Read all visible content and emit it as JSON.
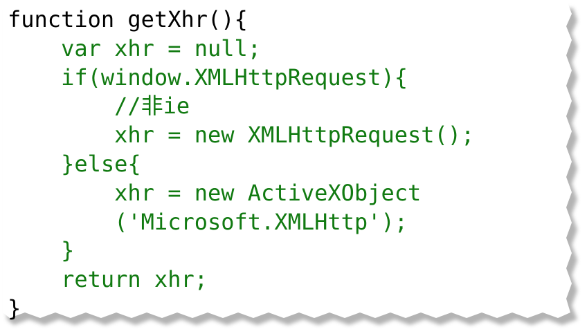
{
  "code": {
    "lines": [
      {
        "text": "function getXhr(){",
        "color": "#000000"
      },
      {
        "text": "    var xhr = null;",
        "color": "#117a11"
      },
      {
        "text": "    if(window.XMLHttpRequest){",
        "color": "#117a11"
      },
      {
        "text": "        //非ie",
        "color": "#117a11"
      },
      {
        "text": "        xhr = new XMLHttpRequest();",
        "color": "#117a11"
      },
      {
        "text": "    }else{",
        "color": "#117a11"
      },
      {
        "text": "        xhr = new ActiveXObject",
        "color": "#117a11"
      },
      {
        "text": "        ('Microsoft.XMLHttp');",
        "color": "#117a11"
      },
      {
        "text": "    }",
        "color": "#117a11"
      },
      {
        "text": "    return xhr;",
        "color": "#117a11"
      },
      {
        "text": "}",
        "color": "#000000"
      }
    ]
  },
  "colors": {
    "keyword_black": "#000000",
    "code_green": "#117a11",
    "paper": "#ffffff",
    "shadow": "#9a9a9a"
  }
}
